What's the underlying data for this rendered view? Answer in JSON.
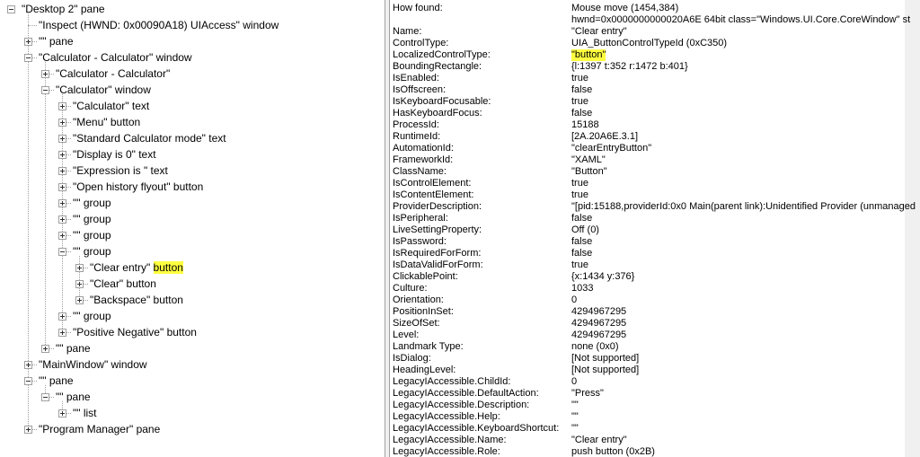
{
  "tree": [
    {
      "label": "\"Desktop 2\" pane",
      "depth": 0,
      "expander": "minus"
    },
    {
      "label": "\"Inspect  (HWND: 0x00090A18) UIAccess\" window",
      "depth": 1,
      "expander": "none"
    },
    {
      "label": "\"\" pane",
      "depth": 1,
      "expander": "plus"
    },
    {
      "label": "\"Calculator - Calculator\" window",
      "depth": 1,
      "expander": "minus"
    },
    {
      "label": "\"Calculator - Calculator\"",
      "depth": 2,
      "expander": "plus"
    },
    {
      "label": "\"Calculator\" window",
      "depth": 2,
      "expander": "minus"
    },
    {
      "label": "\"Calculator\" text",
      "depth": 3,
      "expander": "plus"
    },
    {
      "label": "\"Menu\" button",
      "depth": 3,
      "expander": "plus"
    },
    {
      "label": "\"Standard Calculator mode\" text",
      "depth": 3,
      "expander": "plus"
    },
    {
      "label": "\"Display is 0\" text",
      "depth": 3,
      "expander": "plus"
    },
    {
      "label": "\"Expression is \" text",
      "depth": 3,
      "expander": "plus"
    },
    {
      "label": "\"Open history flyout\" button",
      "depth": 3,
      "expander": "plus"
    },
    {
      "label": "\"\" group",
      "depth": 3,
      "expander": "plus"
    },
    {
      "label": "\"\" group",
      "depth": 3,
      "expander": "plus"
    },
    {
      "label": "\"\" group",
      "depth": 3,
      "expander": "plus"
    },
    {
      "label": "\"\" group",
      "depth": 3,
      "expander": "minus"
    },
    {
      "label": "\"Clear entry\" ",
      "highlight": "button",
      "depth": 4,
      "expander": "plus"
    },
    {
      "label": "\"Clear\" button",
      "depth": 4,
      "expander": "plus"
    },
    {
      "label": "\"Backspace\" button",
      "depth": 4,
      "expander": "plus"
    },
    {
      "label": "\"\" group",
      "depth": 3,
      "expander": "plus"
    },
    {
      "label": "\"Positive Negative\" button",
      "depth": 3,
      "expander": "plus"
    },
    {
      "label": "\"\" pane",
      "depth": 2,
      "expander": "plus"
    },
    {
      "label": "\"MainWindow\" window",
      "depth": 1,
      "expander": "plus"
    },
    {
      "label": "\"\" pane",
      "depth": 1,
      "expander": "minus"
    },
    {
      "label": "\"\" pane",
      "depth": 2,
      "expander": "minus"
    },
    {
      "label": "\"\" list",
      "depth": 3,
      "expander": "plus"
    },
    {
      "label": "\"Program Manager\" pane",
      "depth": 1,
      "expander": "plus"
    }
  ],
  "properties": [
    {
      "name": "How found:",
      "value": "Mouse move (1454,384)"
    },
    {
      "name": "",
      "value": "hwnd=0x0000000000020A6E 64bit class=\"Windows.UI.Core.CoreWindow\" st"
    },
    {
      "name": "Name:",
      "value": "\"Clear entry\""
    },
    {
      "name": "ControlType:",
      "value": "UIA_ButtonControlTypeId (0xC350)"
    },
    {
      "name": "LocalizedControlType:",
      "value": "\"button\"",
      "highlight": true
    },
    {
      "name": "BoundingRectangle:",
      "value": "{l:1397 t:352 r:1472 b:401}"
    },
    {
      "name": "IsEnabled:",
      "value": "true"
    },
    {
      "name": "IsOffscreen:",
      "value": "false"
    },
    {
      "name": "IsKeyboardFocusable:",
      "value": "true"
    },
    {
      "name": "HasKeyboardFocus:",
      "value": "false"
    },
    {
      "name": "ProcessId:",
      "value": "15188"
    },
    {
      "name": "RuntimeId:",
      "value": "[2A.20A6E.3.1]"
    },
    {
      "name": "AutomationId:",
      "value": "\"clearEntryButton\""
    },
    {
      "name": "FrameworkId:",
      "value": "\"XAML\""
    },
    {
      "name": "ClassName:",
      "value": "\"Button\""
    },
    {
      "name": "IsControlElement:",
      "value": "true"
    },
    {
      "name": "IsContentElement:",
      "value": "true"
    },
    {
      "name": "ProviderDescription:",
      "value": "\"[pid:15188,providerId:0x0 Main(parent link):Unidentified Provider (unmanaged"
    },
    {
      "name": "IsPeripheral:",
      "value": "false"
    },
    {
      "name": "LiveSettingProperty:",
      "value": "Off (0)"
    },
    {
      "name": "IsPassword:",
      "value": "false"
    },
    {
      "name": "IsRequiredForForm:",
      "value": "false"
    },
    {
      "name": "IsDataValidForForm:",
      "value": "true"
    },
    {
      "name": "ClickablePoint:",
      "value": "{x:1434 y:376}"
    },
    {
      "name": "Culture:",
      "value": "1033"
    },
    {
      "name": "Orientation:",
      "value": "0"
    },
    {
      "name": "PositionInSet:",
      "value": "4294967295"
    },
    {
      "name": "SizeOfSet:",
      "value": "4294967295"
    },
    {
      "name": "Level:",
      "value": "4294967295"
    },
    {
      "name": "Landmark Type:",
      "value": "none (0x0)"
    },
    {
      "name": "IsDialog:",
      "value": "[Not supported]"
    },
    {
      "name": "HeadingLevel:",
      "value": "[Not supported]"
    },
    {
      "name": "LegacyIAccessible.ChildId:",
      "value": "0"
    },
    {
      "name": "LegacyIAccessible.DefaultAction:",
      "value": "\"Press\""
    },
    {
      "name": "LegacyIAccessible.Description:",
      "value": "\"\""
    },
    {
      "name": "LegacyIAccessible.Help:",
      "value": "\"\""
    },
    {
      "name": "LegacyIAccessible.KeyboardShortcut:",
      "value": "\"\""
    },
    {
      "name": "LegacyIAccessible.Name:",
      "value": "\"Clear entry\""
    },
    {
      "name": "LegacyIAccessible.Role:",
      "value": "push button (0x2B)"
    }
  ],
  "colors": {
    "highlight": "#ffff40",
    "border": "#a0a0a0"
  }
}
